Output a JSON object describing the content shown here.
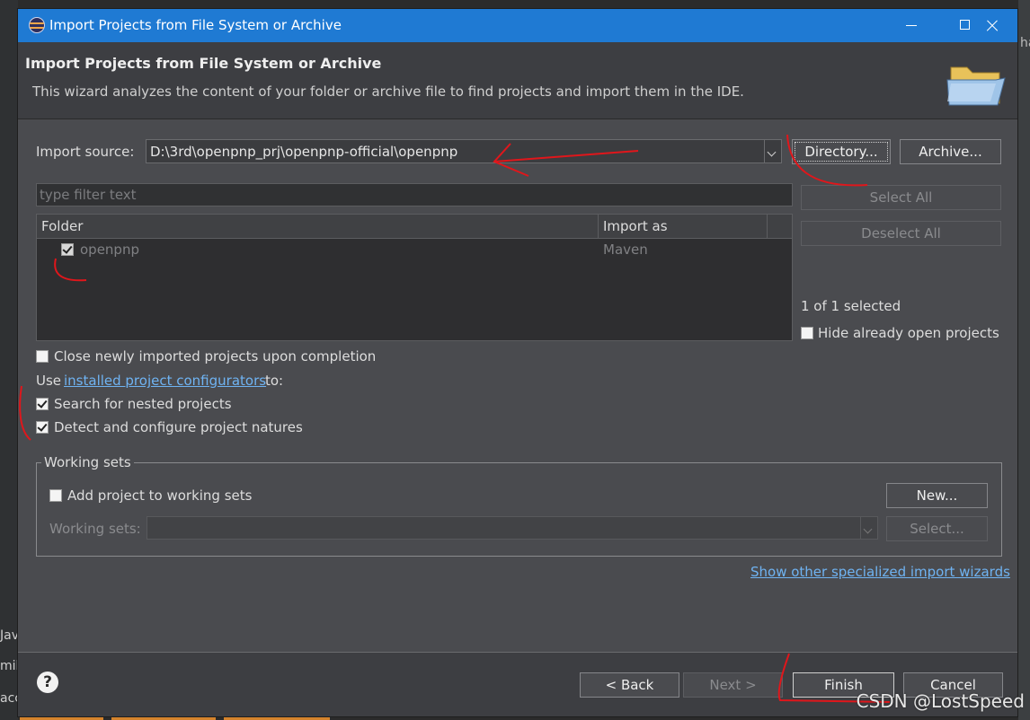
{
  "window": {
    "title": "Import Projects from File System or Archive"
  },
  "header": {
    "title": "Import Projects from File System or Archive",
    "description": "This wizard analyzes the content of your folder or archive file to find projects and import them in the IDE."
  },
  "source": {
    "label": "Import source:",
    "value": "D:\\3rd\\openpnp_prj\\openpnp-official\\openpnp",
    "directory_button": "Directory...",
    "archive_button": "Archive..."
  },
  "filter": {
    "placeholder": "type filter text"
  },
  "table": {
    "columns": [
      "Folder",
      "Import as"
    ],
    "rows": [
      {
        "folder": "openpnp",
        "import_as": "Maven",
        "checked": true
      }
    ]
  },
  "selection": {
    "select_all": "Select All",
    "deselect_all": "Deselect All",
    "count_text": "1 of 1 selected",
    "hide_open": "Hide already open projects"
  },
  "options": {
    "close_imported": "Close newly imported projects upon completion",
    "use_prefix": "Use",
    "configurators_link": "installed project configurators",
    "use_suffix": "to:",
    "search_nested": "Search for nested projects",
    "detect_natures": "Detect and configure project natures"
  },
  "working_sets": {
    "group_label": "Working sets",
    "add_label": "Add project to working sets",
    "new_button": "New...",
    "field_label": "Working sets:",
    "select_button": "Select..."
  },
  "other_wizards_link": "Show other specialized import wizards",
  "footer": {
    "help": "?",
    "back": "< Back",
    "next": "Next >",
    "finish": "Finish",
    "cancel": "Cancel"
  },
  "background": {
    "peek_right": "ha",
    "peek_left_1": "Jav",
    "peek_left_2": "mil",
    "peek_left_3": "acc"
  },
  "watermark": "CSDN @LostSpeed",
  "colors": {
    "titlebar": "#1f7ad3",
    "dialog_bg": "#4a4b4f",
    "link": "#6fb3f2",
    "annotation": "#e0161b"
  },
  "icons": [
    "app-eclipse-icon",
    "minimize-icon",
    "maximize-icon",
    "close-icon",
    "folder-icon",
    "dropdown-arrow-icon",
    "help-icon"
  ]
}
